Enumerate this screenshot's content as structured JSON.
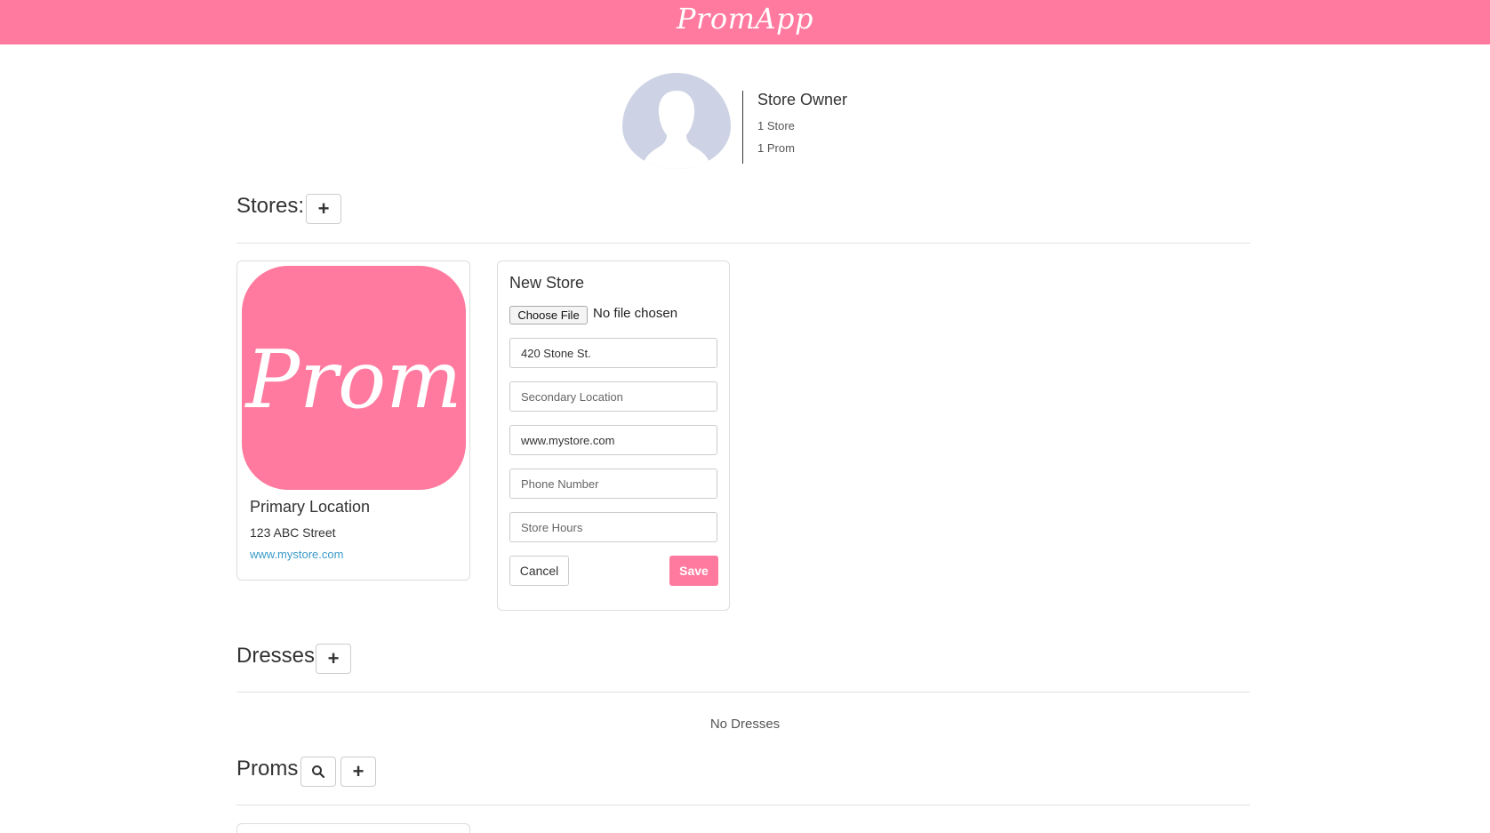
{
  "navbar": {
    "brand": "PromApp"
  },
  "profile": {
    "name": "Store Owner",
    "stores_count": "1 Store",
    "proms_count": "1 Prom"
  },
  "sections": {
    "stores": {
      "title": "Stores:"
    },
    "dresses": {
      "title": "Dresses",
      "empty": "No Dresses"
    },
    "proms": {
      "title": "Proms"
    }
  },
  "store_card": {
    "logo_text": "Prom",
    "title": "Primary Location",
    "address": "123 ABC Street",
    "website": "www.mystore.com"
  },
  "new_store_form": {
    "title": "New Store",
    "file_button": "Choose File",
    "file_status": "No file chosen",
    "fields": {
      "primary_location": {
        "value": "420 Stone St.",
        "placeholder": ""
      },
      "secondary_location": {
        "value": "",
        "placeholder": "Secondary Location"
      },
      "website": {
        "value": "www.mystore.com",
        "placeholder": ""
      },
      "phone": {
        "value": "",
        "placeholder": "Phone Number"
      },
      "hours": {
        "value": "",
        "placeholder": "Store Hours"
      }
    },
    "cancel_label": "Cancel",
    "save_label": "Save"
  },
  "icons": {
    "add": "+",
    "search": "search-icon"
  },
  "colors": {
    "brand_pink": "#ff7a9e",
    "avatar_gray": "#cdd3e4",
    "link_blue": "#3a9bc9"
  }
}
